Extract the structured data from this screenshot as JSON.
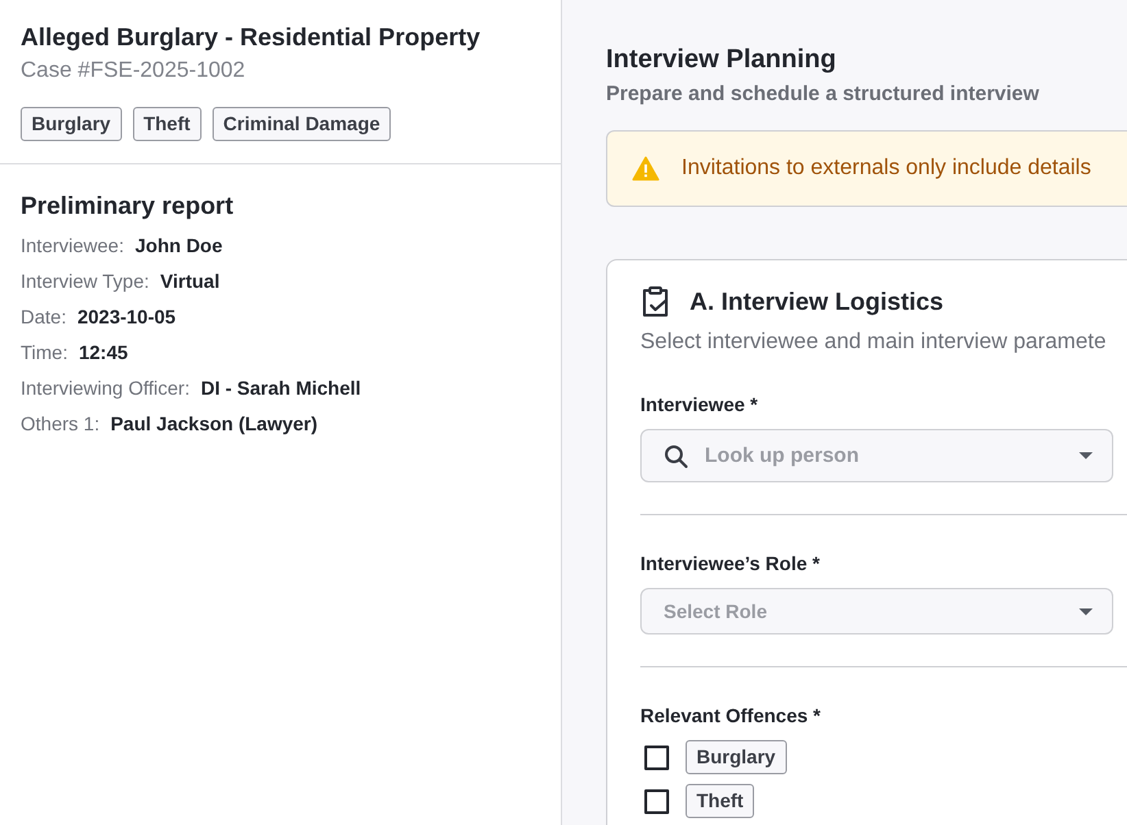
{
  "case": {
    "title": "Alleged Burglary - Residential Property",
    "number": "Case #FSE-2025-1002",
    "tags": [
      "Burglary",
      "Theft",
      "Criminal Damage"
    ]
  },
  "report": {
    "title": "Preliminary report",
    "rows": [
      {
        "label": "Interviewee:",
        "value": "John Doe"
      },
      {
        "label": "Interview Type:",
        "value": "Virtual"
      },
      {
        "label": "Date:",
        "value": "2023-10-05"
      },
      {
        "label": "Time:",
        "value": "12:45"
      },
      {
        "label": "Interviewing Officer:",
        "value": "DI - Sarah Michell"
      },
      {
        "label": "Others 1:",
        "value": "Paul Jackson (Lawyer)"
      }
    ]
  },
  "page": {
    "title": "Interview Planning",
    "subtitle": "Prepare and schedule a structured interview"
  },
  "banner": {
    "text": "Invitations to externals only include details"
  },
  "section": {
    "title": "A. Interview Logistics",
    "subtitle": "Select interviewee and main interview paramete",
    "fields": [
      {
        "kind": "search",
        "label": "Interviewee *",
        "placeholder": "Look up person"
      },
      {
        "kind": "select",
        "label": "Interviewee’s Role *",
        "placeholder": "Select Role"
      },
      {
        "kind": "checklist",
        "label": "Relevant Offences *",
        "options": [
          {
            "label": "Burglary",
            "checked": false
          },
          {
            "label": "Theft",
            "checked": false
          }
        ]
      }
    ]
  }
}
